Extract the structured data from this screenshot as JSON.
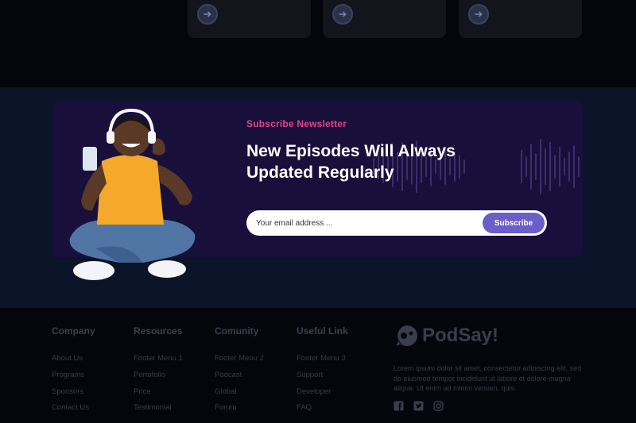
{
  "newsletter": {
    "eyebrow": "Subscribe Newsletter",
    "headline_line1": "New Episodes Will Always",
    "headline_line2": "Updated Regularly",
    "email_placeholder": "Your email address ...",
    "subscribe_label": "Subscribe"
  },
  "footer": {
    "columns": [
      {
        "title": "Company",
        "links": [
          "About Us",
          "Programs",
          "Sponsors",
          "Contact Us"
        ]
      },
      {
        "title": "Resources",
        "links": [
          "Footer Menu 1",
          "Portofolio",
          "Price",
          "Testimonial"
        ]
      },
      {
        "title": "Comunity",
        "links": [
          "Footer Menu 2",
          "Podcast",
          "Global",
          "Forum"
        ]
      },
      {
        "title": "Useful Link",
        "links": [
          "Footer Menu 3",
          "Support",
          "Developer",
          "FAQ"
        ]
      }
    ],
    "brand_name": "PodSay!",
    "about_text": "Lorem ipsum dolor sit amet, consectetur adipiscing elit, sed do eiusmod tempor incididunt ut labore et dolore magna aliqua. Ut enim ad minim veniam, quis.",
    "social_icons": [
      "facebook-icon",
      "twitter-icon",
      "instagram-icon"
    ]
  },
  "colors": {
    "accent": "#e0468e",
    "button": "#6b5ec9",
    "panel": "#190f3b",
    "band": "#0c1429"
  }
}
